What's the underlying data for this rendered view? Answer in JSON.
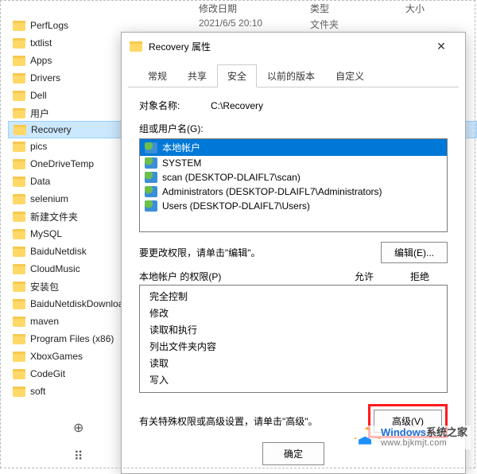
{
  "explorer": {
    "columns": {
      "date": "修改日期",
      "type": "类型",
      "size": "大小"
    },
    "sample_row": {
      "date": "2021/6/5 20:10",
      "type": "文件夹"
    },
    "folders": [
      "PerfLogs",
      "txtlist",
      "Apps",
      "Drivers",
      "Dell",
      "用户",
      "Recovery",
      "pics",
      "OneDriveTemp",
      "Data",
      "selenium",
      "新建文件夹",
      "MySQL",
      "BaiduNetdisk",
      "CloudMusic",
      "安装包",
      "BaiduNetdiskDownload",
      "maven",
      "Program Files (x86)",
      "XboxGames",
      "CodeGit",
      "soft"
    ],
    "selected": "Recovery"
  },
  "dialog": {
    "title": "Recovery 属性",
    "close": "✕",
    "tabs": [
      "常规",
      "共享",
      "安全",
      "以前的版本",
      "自定义"
    ],
    "active_tab": 2,
    "object_label": "对象名称:",
    "object_value": "C:\\Recovery",
    "groups_label": "组或用户名(G):",
    "groups": [
      "本地帐户",
      "SYSTEM",
      "scan (DESKTOP-DLAIFL7\\scan)",
      "Administrators (DESKTOP-DLAIFL7\\Administrators)",
      "Users (DESKTOP-DLAIFL7\\Users)"
    ],
    "selected_group": 0,
    "edit_text": "要更改权限，请单击\"编辑\"。",
    "edit_btn": "编辑(E)...",
    "perm_header": {
      "name": "本地帐户 的权限(P)",
      "allow": "允许",
      "deny": "拒绝"
    },
    "permissions": [
      "完全控制",
      "修改",
      "读取和执行",
      "列出文件夹内容",
      "读取",
      "写入"
    ],
    "adv_text": "有关特殊权限或高级设置，请单击\"高级\"。",
    "adv_btn": "高级(V)",
    "ok_btn": "确定"
  },
  "watermark": {
    "brand_prefix": "Windows",
    "brand_suffix": "系统之家",
    "url": "www.bjkmjt.com"
  }
}
